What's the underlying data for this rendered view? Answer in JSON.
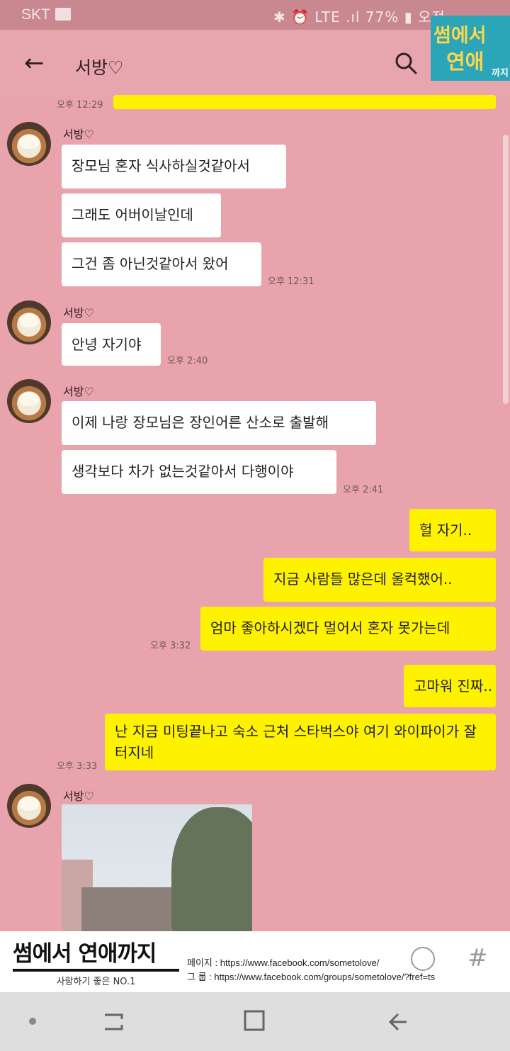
{
  "status_bar": {
    "carrier": "SKT",
    "right_text": "✱ ⏰ LTE .ıl 77% ▮ 오전"
  },
  "header": {
    "back_icon": "←",
    "title": "서방♡",
    "search_icon": "search-icon"
  },
  "promo_badge": {
    "line1": "썸에서",
    "line2": "연애",
    "line3": "까지"
  },
  "messages": {
    "top_time": "오후 12:29",
    "group1": {
      "sender": "서방♡",
      "lines": [
        "장모님 혼자 식사하실것같아서",
        "그래도 어버이날인데",
        "그건 좀 아닌것같아서 왔어"
      ],
      "time": "오후 12:31"
    },
    "group2": {
      "sender": "서방♡",
      "lines": [
        "안녕 자기야"
      ],
      "time": "오후 2:40"
    },
    "group3": {
      "sender": "서방♡",
      "lines": [
        "이제 나랑 장모님은 장인어른 산소로 출발해",
        "생각보다 차가 없는것같아서 다행이야"
      ],
      "time": "오후 2:41"
    },
    "mine1": {
      "lines": [
        "헐 자기..",
        "지금 사람들 많은데 울컥했어..",
        "엄마 좋아하시겠다 멀어서 혼자 못가는데"
      ],
      "time": "오후 3:32"
    },
    "mine2": {
      "lines": [
        "고마워 진짜..",
        "난 지금 미팅끝나고 숙소 근처 스타벅스야 여기 와이파이가 잘터지네"
      ],
      "time": "오후 3:33"
    },
    "group4": {
      "sender": "서방♡"
    }
  },
  "banner": {
    "brand": "썸에서 연애까지",
    "brand_sub": "사랑하기 좋은 NO.1",
    "page_line": "페이지 : https://www.facebook.com/sometolove/",
    "group_line": "그    룹 : https://www.facebook.com/groups/sometolove/?fref=ts"
  },
  "colors": {
    "chat_bg": "#e9a3ac",
    "mine_bubble": "#fff200",
    "other_bubble": "#ffffff",
    "promo_bg": "#2aa6b8"
  }
}
